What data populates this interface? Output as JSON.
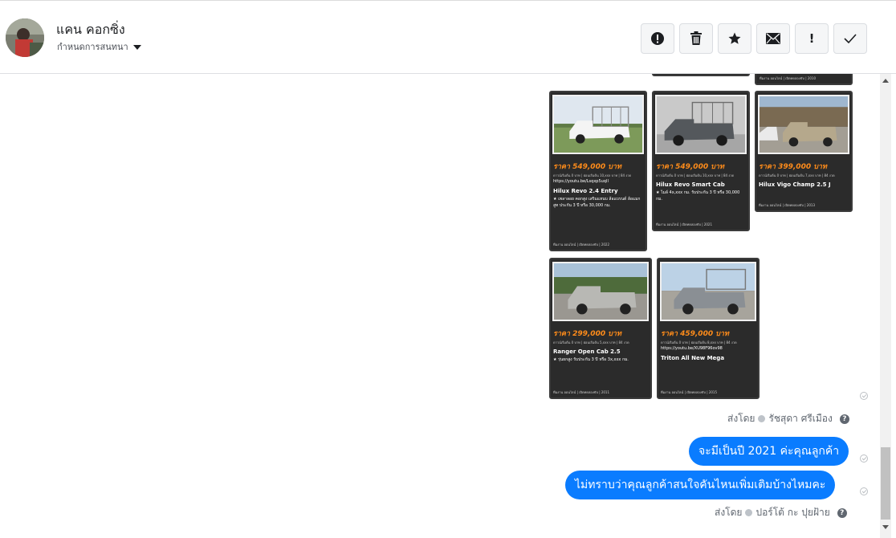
{
  "header": {
    "contact_name": "แคน คอกซิ่ง",
    "conversation_settings": "กำหนดการสนทนา",
    "actions": [
      "report-icon",
      "trash-icon",
      "star-icon",
      "envelope-icon",
      "exclamation-icon",
      "check-icon"
    ],
    "action_exclamation_text": "!"
  },
  "cards": [
    {
      "price": "ราคา 549,000 บาท",
      "info": "ดาวน์เริ่มต้น 0 บาท | ผ่อนเริ่มต้น 10,xxx บาท | 84 งวด",
      "model": "Hilux Revo 2.4 Entry",
      "desc": "★ เพลาลอย คอกสูง เสริมแหนบ ล้อแบรนด์ ล้อแมกสูท ประกัน 3 ปี หรือ 30,000 กม.",
      "link": "https://youtu.be/Lsqxp5uqII",
      "foot": "ทีมงาน ออนไลน์ | เปิดทดลองขับ | 2022"
    },
    {
      "price": "ราคา 549,000 บาท",
      "info": "ดาวน์เริ่มต้น 0 บาท | ผ่อนเริ่มต้น 10,xxx บาท | 84 งวด",
      "model": "Hilux Revo Smart Cab",
      "desc": "★ ไมล์ 4x,xxx กม. รับประกัน 3 ปี หรือ 30,000 กม.",
      "link": "",
      "foot": "ทีมงาน ออนไลน์ | เปิดทดลองขับ | 2021"
    },
    {
      "price": "ราคา 399,000 บาท",
      "info": "ดาวน์เริ่มต้น 0 บาท | ผ่อนเริ่มต้น 7,xxx บาท | 84 งวด",
      "model": "Hilux Vigo Champ 2.5 J",
      "desc": "",
      "link": "",
      "foot": "ทีมงาน ออนไลน์ | เปิดทดลองขับ | 2013"
    },
    {
      "price": "ราคา 299,000 บาท",
      "info": "ดาวน์เริ่มต้น 0 บาท | ผ่อนเริ่มต้น 5,xxx บาท | 84 งวด",
      "model": "Ranger Open Cab 2.5",
      "desc": "★ รุ่นยกสูง รับประกัน 3 ปี หรือ 3x,xxx กม.",
      "link": "",
      "foot": "ทีมงาน ออนไลน์ | เปิดทดลองขับ | 2011"
    },
    {
      "price": "ราคา 459,000 บาท",
      "info": "ดาวน์เริ่มต้น 0 บาท | ผ่อนเริ่มต้น 8,xxx บาท | 84 งวด",
      "model": "Triton All New Mega",
      "desc": "",
      "link": "https://youtu.be/XU98F96ov98",
      "foot": "ทีมงาน ออนไลน์ | เปิดทดลองขับ | 2015"
    }
  ],
  "top_card_foot": "ทีมงาน ออนไลน์ | เปิดทดลองขับ | 2010",
  "messages": {
    "sent_by_prefix": "ส่งโดย",
    "sender_1": "รัชสุดา ศรีเมือง",
    "bubble_1": "จะมีเป็นปี 2021 ค่ะคุณลูกค้า",
    "bubble_2": "ไม่ทราบว่าคุณลูกค้าสนใจคันไหนเพิ่มเติมบ้างไหมคะ",
    "sender_2": "ปอร์โต้ กะ ปุยฝ้าย",
    "help": "?"
  },
  "colors": {
    "bubble": "#0a7cff",
    "card_bg": "#2b2b2b",
    "price": "#ff8c1a"
  }
}
